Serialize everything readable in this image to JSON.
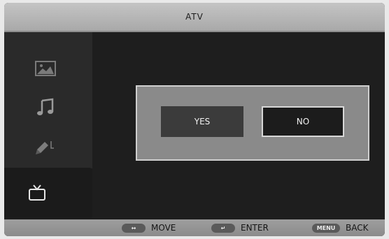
{
  "title": "ATV",
  "sidebar": {
    "items": [
      {
        "icon": "picture-icon"
      },
      {
        "icon": "music-note-icon"
      },
      {
        "icon": "edit-icon"
      },
      {
        "icon": "tv-icon"
      }
    ]
  },
  "dialog": {
    "yes_label": "YES",
    "no_label": "NO"
  },
  "footer": {
    "move_label": "MOVE",
    "enter_label": "ENTER",
    "menu_key": "MENU",
    "back_label": "BACK"
  }
}
